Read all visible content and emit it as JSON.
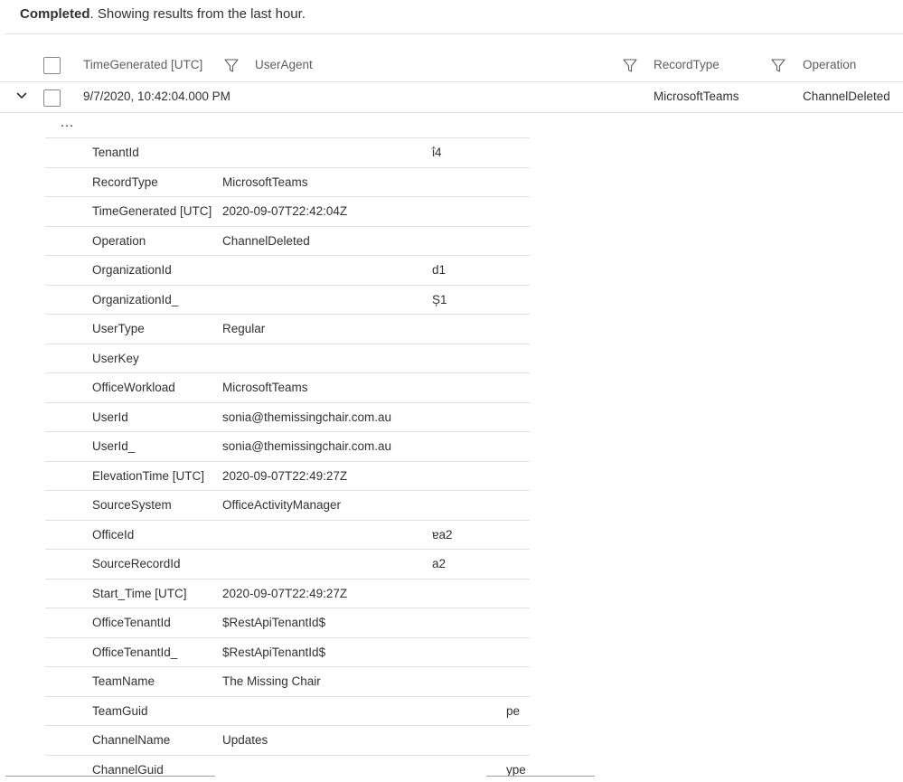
{
  "status": {
    "strong": "Completed",
    "rest": ". Showing results from the last hour."
  },
  "columns": {
    "time_generated": "TimeGenerated [UTC]",
    "user_agent": "UserAgent",
    "record_type": "RecordType",
    "operation": "Operation"
  },
  "row": {
    "time_generated": "9/7/2020, 10:42:04.000 PM",
    "record_type": "MicrosoftTeams",
    "operation": "ChannelDeleted"
  },
  "more": "…",
  "details": [
    {
      "key": "TenantId",
      "value": "ΐ4",
      "offset": "partial"
    },
    {
      "key": "RecordType",
      "value": "MicrosoftTeams"
    },
    {
      "key": "TimeGenerated [UTC]",
      "value": "2020-09-07T22:42:04Z"
    },
    {
      "key": "Operation",
      "value": "ChannelDeleted"
    },
    {
      "key": "OrganizationId",
      "value": "d1",
      "offset": "partial"
    },
    {
      "key": "OrganizationId_",
      "value": "Ș1",
      "offset": "partial"
    },
    {
      "key": "UserType",
      "value": "Regular"
    },
    {
      "key": "UserKey",
      "value": ""
    },
    {
      "key": "OfficeWorkload",
      "value": "MicrosoftTeams"
    },
    {
      "key": "UserId",
      "value": "sonia@themissingchair.com.au"
    },
    {
      "key": "UserId_",
      "value": "sonia@themissingchair.com.au"
    },
    {
      "key": "ElevationTime [UTC]",
      "value": "2020-09-07T22:49:27Z"
    },
    {
      "key": "SourceSystem",
      "value": "OfficeActivityManager"
    },
    {
      "key": "OfficeId",
      "value": "ɐa2",
      "offset": "partial"
    },
    {
      "key": "SourceRecordId",
      "value": "a2",
      "offset": "partial"
    },
    {
      "key": "Start_Time [UTC]",
      "value": "2020-09-07T22:49:27Z"
    },
    {
      "key": "OfficeTenantId",
      "value": "$RestApiTenantId$"
    },
    {
      "key": "OfficeTenantId_",
      "value": "$RestApiTenantId$"
    },
    {
      "key": "TeamName",
      "value": "The Missing Chair"
    },
    {
      "key": "TeamGuid",
      "value": "pe",
      "offset": "far"
    },
    {
      "key": "ChannelName",
      "value": "Updates"
    },
    {
      "key": "ChannelGuid",
      "value": "ype",
      "offset": "far"
    }
  ]
}
